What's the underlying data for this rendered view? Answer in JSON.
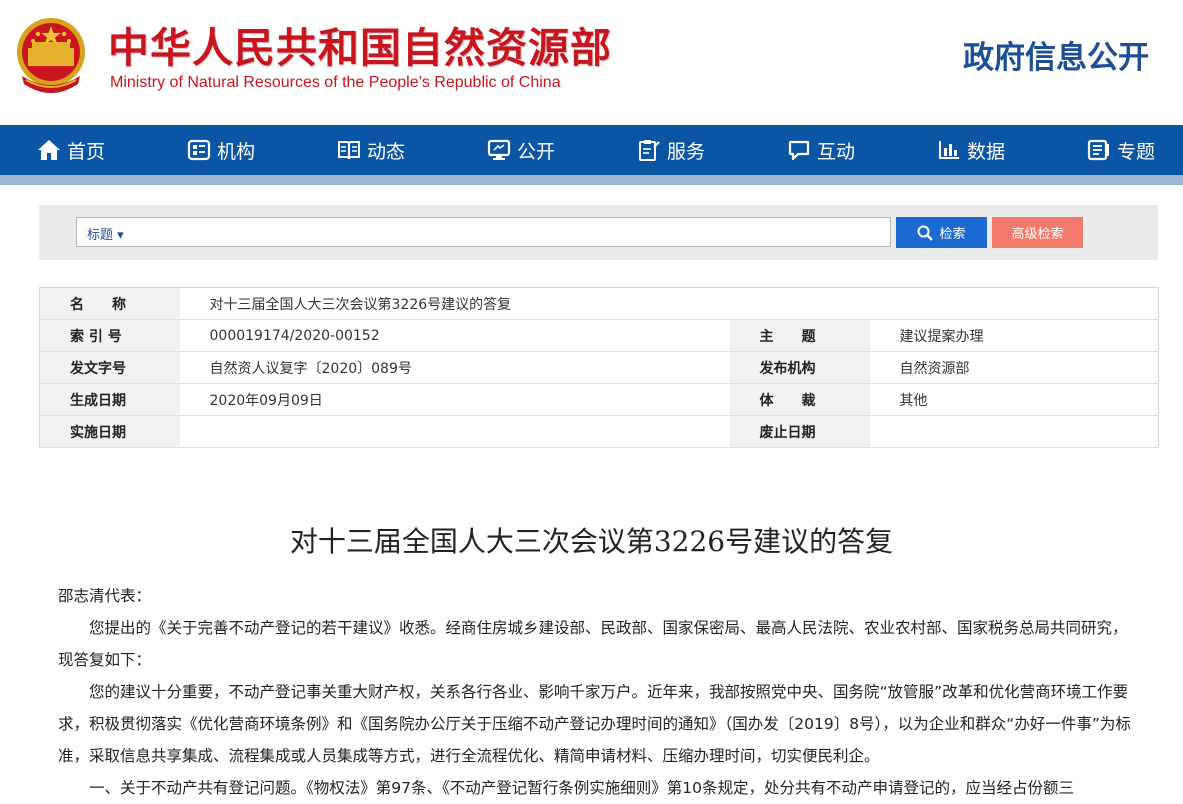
{
  "header": {
    "title_cn": "中华人民共和国自然资源部",
    "title_en": "Ministry of Natural Resources of the People’s Republic of China",
    "right_title": "政府信息公开"
  },
  "nav": {
    "items": [
      {
        "label": "首页",
        "icon": "home-icon"
      },
      {
        "label": "机构",
        "icon": "org-icon"
      },
      {
        "label": "动态",
        "icon": "news-icon"
      },
      {
        "label": "公开",
        "icon": "monitor-icon"
      },
      {
        "label": "服务",
        "icon": "service-icon"
      },
      {
        "label": "互动",
        "icon": "chat-icon"
      },
      {
        "label": "数据",
        "icon": "bar-chart-icon"
      },
      {
        "label": "专题",
        "icon": "topic-icon"
      }
    ]
  },
  "search": {
    "type_label": "标题 ▾",
    "placeholder": "",
    "search_button": "检索",
    "advanced_button": "高级检索"
  },
  "meta": {
    "name_key": "名　　称",
    "name_val": "对十三届全国人大三次会议第3226号建议的答复",
    "index_key": "索 引 号",
    "index_val": "000019174/2020-00152",
    "subject_key": "主　　题",
    "subject_val": "建议提案办理",
    "docno_key": "发文字号",
    "docno_val": "自然资人议复字〔2020〕089号",
    "issuer_key": "发布机构",
    "issuer_val": "自然资源部",
    "date_key": "生成日期",
    "date_val": "2020年09月09日",
    "genre_key": "体　　裁",
    "genre_val": "其他",
    "impl_key": "实施日期",
    "impl_val": "",
    "abolish_key": "废止日期",
    "abolish_val": ""
  },
  "document": {
    "title": "对十三届全国人大三次会议第3226号建议的答复",
    "salutation": "邵志清代表：",
    "para1": "您提出的《关于完善不动产登记的若干建议》收悉。经商住房城乡建设部、民政部、国家保密局、最高人民法院、农业农村部、国家税务总局共同研究，现答复如下：",
    "para2": "您的建议十分重要，不动产登记事关重大财产权，关系各行各业、影响千家万户。近年来，我部按照党中央、国务院“放管服”改革和优化营商环境工作要求，积极贯彻落实《优化营商环境条例》和《国务院办公厅关于压缩不动产登记办理时间的通知》（国办发〔2019〕8号），以为企业和群众“办好一件事”为标准，采取信息共享集成、流程集成或人员集成等方式，进行全流程优化、精简申请材料、压缩办理时间，切实便民利企。",
    "para3": "一、关于不动产共有登记问题。《物权法》第97条、《不动产登记暂行条例实施细则》第10条规定，处分共有不动产申请登记的，应当经占份额三"
  },
  "colors": {
    "brand_red": "#c8161e",
    "nav_blue": "#0a56a5",
    "title_blue": "#1c4f96",
    "search_blue": "#1a6ad1",
    "advanced_red": "#f37a6b"
  }
}
